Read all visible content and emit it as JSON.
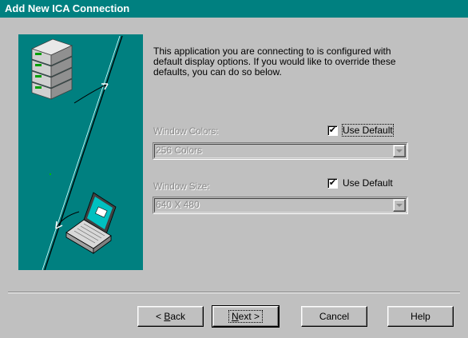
{
  "window": {
    "title": "Add New ICA Connection"
  },
  "intro_text": "This application you are connecting to is configured with\ndefault display options.  If you would like to override these\ndefaults, you can do so below.",
  "window_colors": {
    "label": "Window Colors:",
    "use_default_label": "Use Default",
    "use_default_checked": true,
    "value": "256 Colors"
  },
  "window_size": {
    "label": "Window Size:",
    "use_default_label": "Use Default",
    "use_default_checked": true,
    "value": "640 X 480"
  },
  "buttons": {
    "back_prefix": "< ",
    "back_mnemonic": "B",
    "back_rest": "ack",
    "next_mnemonic": "N",
    "next_rest": "ext >",
    "cancel": "Cancel",
    "help": "Help"
  },
  "colors": {
    "title_bar": "#008080",
    "panel": "#008080",
    "dialog": "#c0c0c0",
    "screen": "#00c0c0"
  },
  "icons": {
    "server": "server-stack-icon",
    "laptop": "laptop-icon",
    "check": "checkmark-icon",
    "dropdown": "dropdown-arrow-icon"
  }
}
